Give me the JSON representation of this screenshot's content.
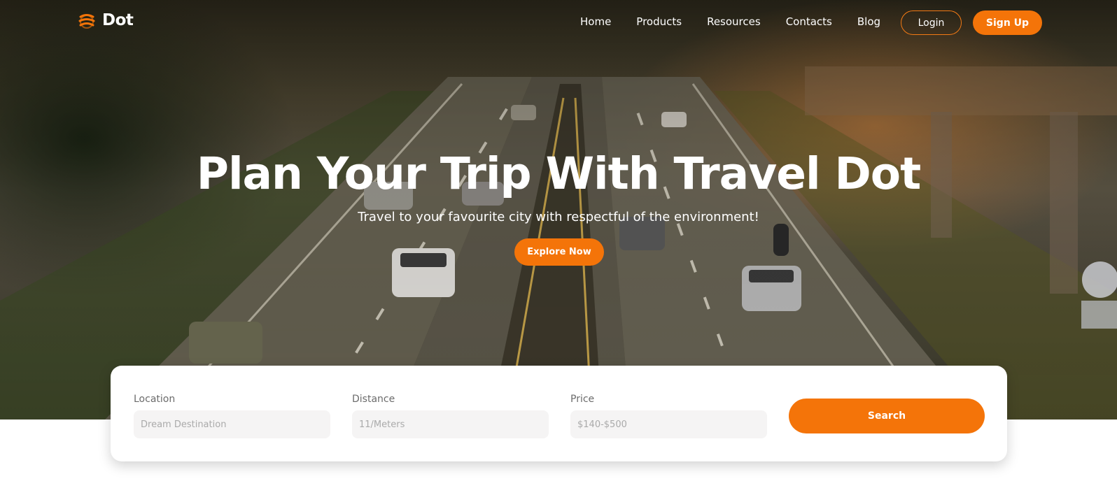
{
  "brand": {
    "name": "Dot",
    "icon": "globe-logo-icon"
  },
  "nav": {
    "items": [
      "Home",
      "Products",
      "Resources",
      "Contacts",
      "Blog"
    ],
    "login_label": "Login",
    "signup_label": "Sign Up"
  },
  "hero": {
    "title": "Plan Your Trip With Travel Dot",
    "subtitle": "Travel to your favourite city with respectful of the environment!",
    "cta_label": "Explore Now",
    "background": "highway-with-cars-photo"
  },
  "search": {
    "location": {
      "label": "Location",
      "placeholder": "Dream Destination"
    },
    "distance": {
      "label": "Distance",
      "placeholder": "11/Meters"
    },
    "price": {
      "label": "Price",
      "placeholder": "$140-$500"
    },
    "button_label": "Search"
  },
  "colors": {
    "accent": "#f47409",
    "white": "#ffffff",
    "field_bg": "#f5f4f4"
  }
}
